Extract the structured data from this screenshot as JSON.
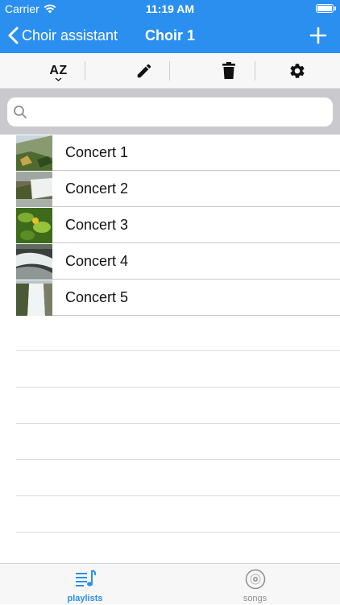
{
  "status": {
    "carrier": "Carrier",
    "time": "11:19 AM",
    "battery_level": 1.0
  },
  "nav": {
    "back_label": "Choir assistant",
    "title": "Choir 1",
    "add_icon": "plus-icon"
  },
  "toolbar": {
    "sort_label": "AZ",
    "items": [
      "sort-az-icon",
      "pencil-icon",
      "trash-icon",
      "gear-icon"
    ]
  },
  "search": {
    "placeholder": "",
    "value": ""
  },
  "playlists": [
    {
      "title": "Concert 1",
      "thumb": "landscape-thumbnail"
    },
    {
      "title": "Concert 2",
      "thumb": "waterfall-thumbnail"
    },
    {
      "title": "Concert 3",
      "thumb": "leaves-thumbnail"
    },
    {
      "title": "Concert 4",
      "thumb": "stream-thumbnail"
    },
    {
      "title": "Concert 5",
      "thumb": "cascade-thumbnail"
    }
  ],
  "tabs": [
    {
      "label": "playlists",
      "icon": "playlist-icon",
      "active": true
    },
    {
      "label": "songs",
      "icon": "disc-icon",
      "active": false
    }
  ],
  "colors": {
    "accent": "#2b8ff0",
    "tab_inactive": "#8e8e93",
    "search_bg": "#c9c9ce"
  }
}
